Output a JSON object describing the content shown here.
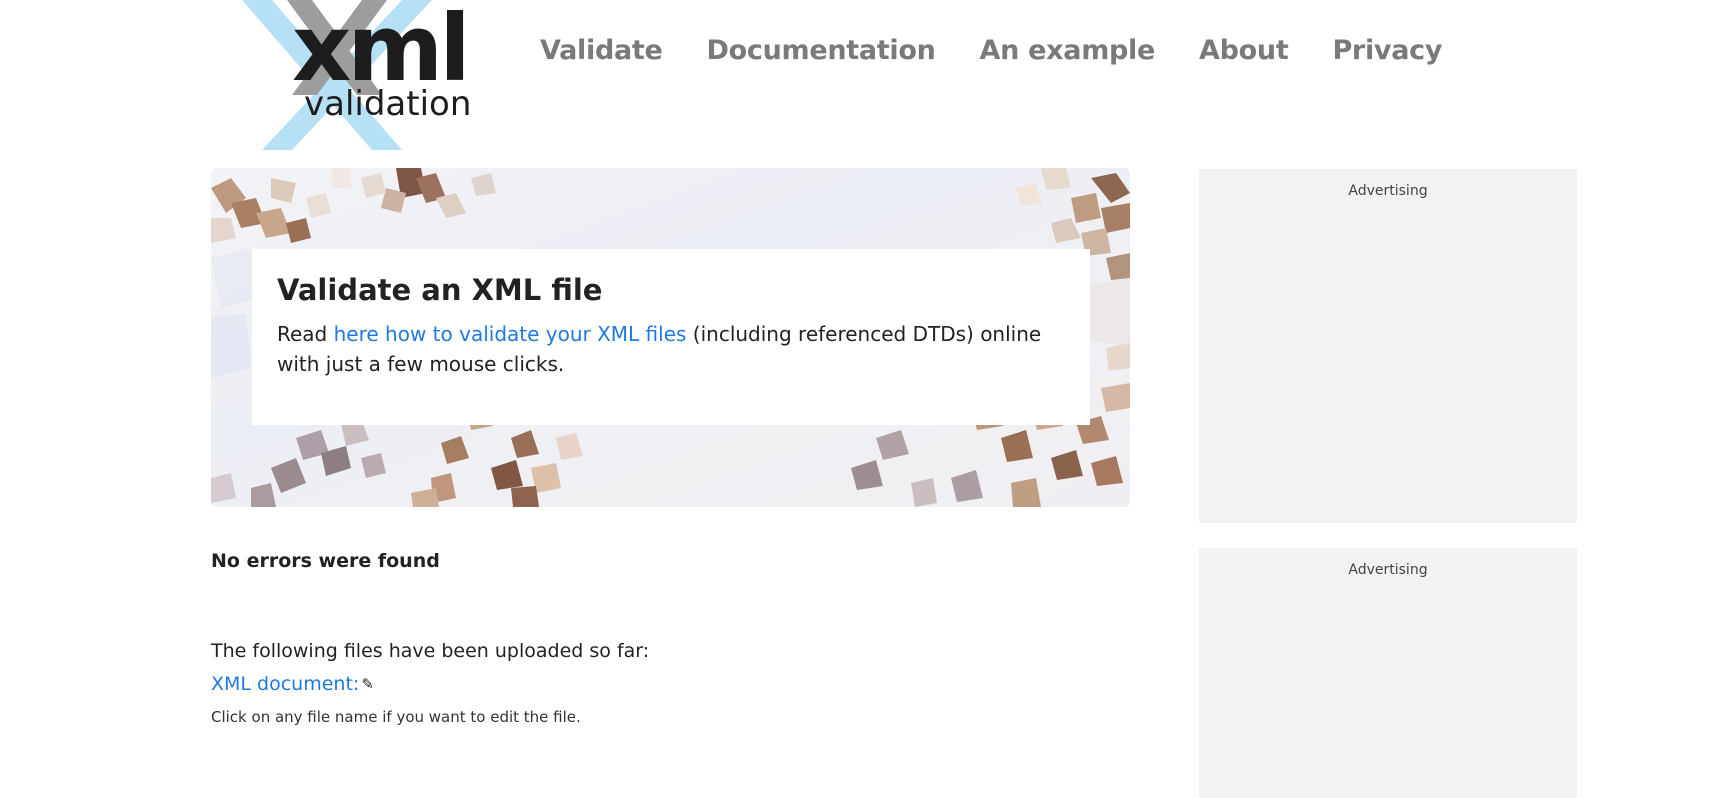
{
  "logo": {
    "word": "xml",
    "sub": "validation",
    "accent_color": "#b6e1f4",
    "mark_color": "#9d9d9d"
  },
  "nav": [
    "Validate",
    "Documentation",
    "An example",
    "About",
    "Privacy"
  ],
  "hero": {
    "title": "Validate an XML file",
    "text_before": "Read ",
    "link": "here how to validate your XML files",
    "text_after": " (including referenced DTDs) online with just a few mouse clicks."
  },
  "result": "No errors were found",
  "uploaded_label": "The following files have been uploaded so far:",
  "file_link": "XML document:",
  "pencil": "✎",
  "hint": "Click on any file name if you want to edit the file.",
  "ads": [
    "Advertising",
    "Advertising"
  ],
  "colors": {
    "link": "#1f7ae0",
    "nav": "#7a7a7a",
    "ad_bg": "#f2f2f2"
  }
}
